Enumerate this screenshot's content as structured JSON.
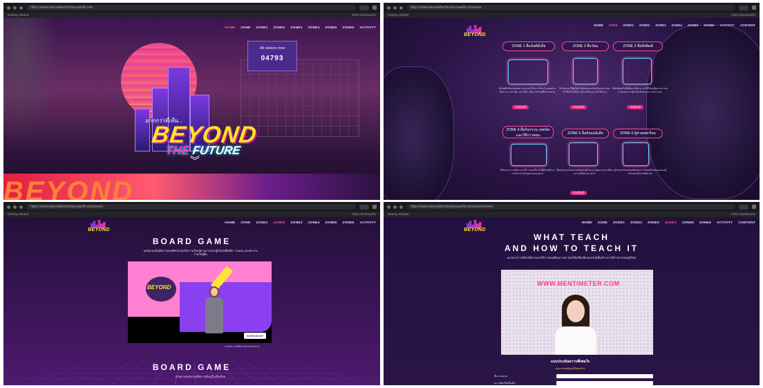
{
  "window": {
    "q1_url": "https://www.beyondtechnoloycasefit.com",
    "q2_url": "https://www.beyondtechnoloycasefit.com/zone",
    "q3_url": "https://www.beyondtechnoloycasefit.com/zone3",
    "q4_url": "https://www.beyondtechnoloycasefit.com/zone4/zone1",
    "bookmarks": "Getting Started",
    "other_bookmarks": "Other Bookmarks",
    "zoom": "90%"
  },
  "menu": {
    "home": "HOME",
    "items": [
      "ZONE",
      "ZONE1",
      "ZONE2",
      "ZONE3",
      "ZONE4",
      "ZONE5",
      "ZONE6",
      "ACTIVITY",
      "CONTENT"
    ]
  },
  "home": {
    "counter_label": "All visitors now",
    "counter_value": "04793",
    "tagline": "มากกว่าที่เห็น...",
    "title_1": "BEYOND",
    "title_2a": "THE",
    "title_2b": "FUTURE",
    "band_text": "BEYOND",
    "scroll_icon": "chevrons-down-icon"
  },
  "zones": {
    "items": [
      {
        "title": "ZONE 1 สื่อมัลติมีเดีย",
        "text": "สื่อมัลติมีเดียช่วยเพิ่มความน่าสนใจในการเรียนรู้ ผสมผสานข้อความ ภาพ เสียง และวิดีโอ เพื่อการเรียนรู้ที่หลากหลาย",
        "button": "เข้าสู่โซนนี้"
      },
      {
        "title": "ZONE 2 สื่อวัตถุ",
        "text": "สื่อวัตถุช่วยให้ผู้เรียนได้สัมผัสของจริงหรือแบบจำลอง ทำให้เข้าใจเนื้อหาได้ง่ายขึ้นและจดจำได้นาน",
        "button": "เข้าสู่โซนนี้"
      },
      {
        "title": "ZONE 3 สื่อสิ่งพิมพ์",
        "text": "สื่อสิ่งพิมพ์เป็นสื่อพื้นฐานที่สามารถใช้ได้ทุกที่ทุกเวลา ช่วยถ่ายทอดความรู้ผ่านตัวอักษรและภาพประกอบ",
        "button": "เข้าสู่โซนนี้"
      },
      {
        "title": "ZONE 4 สื่อกิจกรรม เทคนิค และวิธีการสอน",
        "text": "สื่อกิจกรรม เทคนิค และวิธีการสอนที่ช่วยให้ผู้เรียนมีส่วนร่วมในการเรียนรู้อย่างสนุกสนาน",
        "button": "เข้าสู่โซนนี้"
      },
      {
        "title": "ZONE 5 สื่อสังคมมิเดีย",
        "text": "สื่อสังคมออนไลน์ช่วยเชื่อมต่อผู้เรียนและผู้สอน แลกเปลี่ยนความรู้ได้อย่างรวดเร็ว",
        "button": "เข้าสู่โซนนี้"
      },
      {
        "title": "ZONE 6 ผู้ช่วยบทเรียน",
        "text": "ผู้ช่วยบทเรียนช่วยสนับสนุนการเรียนรู้ด้วยตนเองของผู้เรียนอย่างมีประสิทธิภาพ",
        "button": "เข้าสู่โซนนี้"
      }
    ]
  },
  "boardgame": {
    "heading": "BOARD GAME",
    "desc": "บอร์ดเกมเป็นสื่อการสอนที่ช่วยส่งเสริมการเรียนรู้ผ่านการเล่น ผู้เรียนได้ฝึกคิด วางแผน และทำงานร่วมกับผู้อื่น",
    "video_logo": "BEYOND",
    "video_badge": "WORKSHOP",
    "caption": "ภาพประกอบสื่อการสอนบอร์ดเกม",
    "heading_2": "BOARD GAME",
    "desc_2": "ตัวอย่างบอร์ดเกมเพื่อการเรียนรู้ในชั้นเรียน"
  },
  "teach": {
    "heading_1": "WHAT TEACH",
    "heading_2": "AND HOW TO TEACH IT",
    "desc": "แนวทางการเลือกเนื้อหาและวิธีการสอนที่เหมาะสม โดยใช้เครื่องมือออนไลน์เพื่อสร้างการมีส่วนร่วมของผู้เรียน",
    "video_url_text": "WWW.MENTIMETER.COM",
    "form_title": "แบบประเมินความพึงพอใจ",
    "form_sub": "กรุณากรอกข้อมูลให้ครบถ้วน",
    "form_label_1": "ชื่อ-นามสกุล",
    "form_label_2": "ความคิดเห็นเพิ่มเติม"
  }
}
